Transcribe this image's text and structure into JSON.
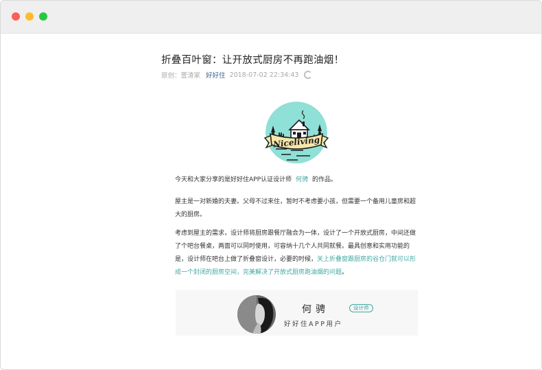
{
  "window": {
    "controls": [
      "close",
      "minimize",
      "maximize"
    ]
  },
  "article": {
    "title": "折叠百叶窗：让开放式厨房不再跑油烟！",
    "meta": {
      "original_label": "原创：",
      "author": "萱渣家",
      "source": "好好住",
      "datetime": "2018-07-02 22:34:43"
    },
    "logo": {
      "text": "Niceliving",
      "colors": {
        "mint": "#8fe0d6",
        "dark": "#1d1d1d",
        "banner": "#f5e7a9"
      }
    },
    "paragraph1": {
      "before": "今天和大家分享的是好好住APP认证设计师",
      "designer_link": "何骋",
      "after": "的作品。"
    },
    "paragraph2": "屋主是一对新婚的夫妻。父母不过来住，暂时不考虑要小孩，但需要一个备用儿童房和超大的厨房。",
    "paragraph3": {
      "text": "考虑到屋主的需求，设计师将厨房跟餐厅融合为一体，设计了一个开放式厨房，中间还做了个吧台餐桌，两面可以同时使用，可容纳十几个人共同就餐。最具创意和实用功能的是，设计师在吧台上做了折叠窗设计，必要的时候，",
      "highlight": "关上折叠窗跟厨房的谷仓门就可以形成一个封闭的厨房空间，完美解决了开放式厨房跑油烟的问题",
      "end": "。"
    },
    "designer_card": {
      "name": "何骋",
      "badge": "设计师",
      "user_type": "好好住APP用户"
    }
  },
  "colors": {
    "accent": "#3fa8a1",
    "brand_link": "#3a5a8a",
    "meta_gray": "#a8a8a8",
    "titlebar": "#efefef"
  }
}
